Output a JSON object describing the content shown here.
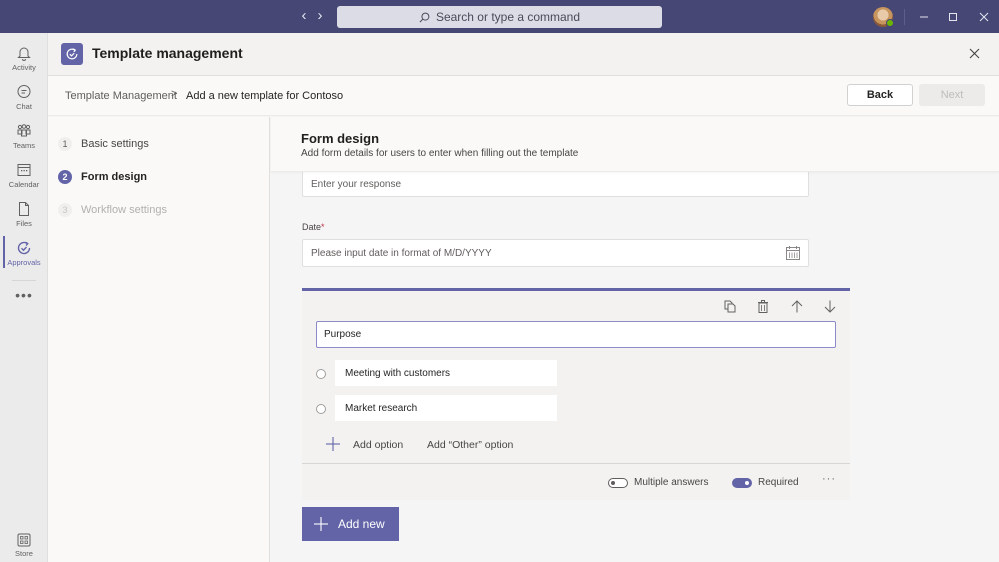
{
  "titlebar": {
    "search_placeholder": "Search or type a command",
    "back_arrow": "‹",
    "forward_arrow": "›"
  },
  "rail": {
    "items": [
      {
        "label": "Activity",
        "icon": "bell-icon"
      },
      {
        "label": "Chat",
        "icon": "chat-icon"
      },
      {
        "label": "Teams",
        "icon": "teams-icon"
      },
      {
        "label": "Calendar",
        "icon": "calendar-icon"
      },
      {
        "label": "Files",
        "icon": "file-icon"
      },
      {
        "label": "Approvals",
        "icon": "approvals-icon",
        "active": true
      }
    ],
    "more_label": "•••",
    "store_label": "Store"
  },
  "header": {
    "title": "Template management"
  },
  "breadcrumb": {
    "items": [
      "Template Management",
      "Add a new template for Contoso"
    ],
    "separator": ">"
  },
  "actions": {
    "back_label": "Back",
    "next_label": "Next"
  },
  "steps": [
    {
      "number": "1",
      "label": "Basic settings",
      "state": "done"
    },
    {
      "number": "2",
      "label": "Form design",
      "state": "active"
    },
    {
      "number": "3",
      "label": "Workflow settings",
      "state": "disabled"
    }
  ],
  "form": {
    "title": "Form design",
    "subtitle": "Add form details for users to enter when filling out the template",
    "response_placeholder": "Enter your response",
    "date_label": "Date",
    "date_required_mark": "*",
    "date_placeholder": "Please input date in format of M/D/YYYY",
    "question": {
      "title": "Purpose",
      "options": [
        "Meeting with customers",
        "Market research"
      ],
      "add_option_label": "Add option",
      "add_other_label": "Add “Other” option",
      "multiple_answers_label": "Multiple answers",
      "multiple_answers_on": false,
      "required_label": "Required",
      "required_on": true,
      "more_label": "···"
    },
    "add_new_label": "Add new"
  },
  "colors": {
    "brand": "#6264a7",
    "titlebar": "#464775",
    "required": "#c4314b",
    "presence": "#6bb700"
  }
}
